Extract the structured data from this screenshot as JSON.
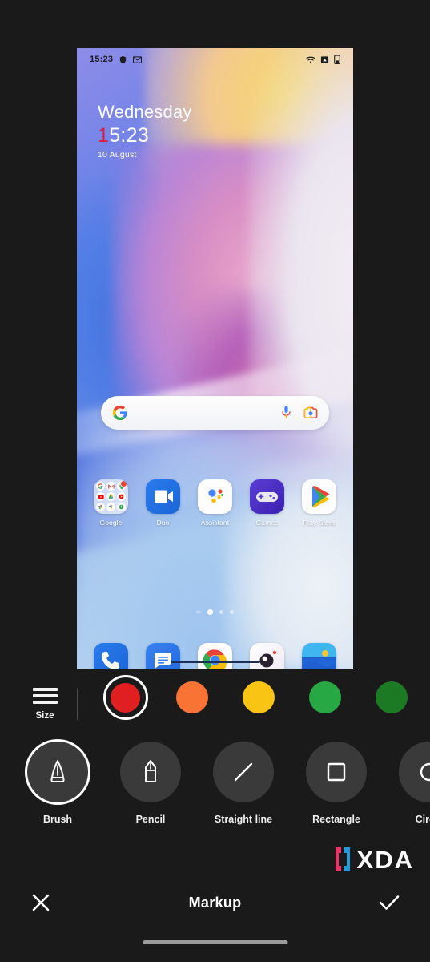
{
  "app": {
    "title": "Markup",
    "background": "#1a1a1a"
  },
  "preview": {
    "statusbar": {
      "time": "15:23",
      "left_icons": [
        "shield-icon",
        "mail-icon"
      ],
      "right_icons": [
        "wifi-icon",
        "cellular-signal-icon",
        "battery-icon"
      ]
    },
    "clock_widget": {
      "day": "Wednesday",
      "time_accent": "1",
      "time_rest": "5:23",
      "date": "10 August",
      "accent_color": "#d81f3c"
    },
    "search_bar": {
      "placeholder": "",
      "icons": [
        "google-g-icon",
        "microphone-icon",
        "google-lens-icon"
      ]
    },
    "apps": [
      {
        "label": "Google",
        "icon": "google-folder-icon",
        "badge": true
      },
      {
        "label": "Duo",
        "icon": "google-duo-icon",
        "badge": false
      },
      {
        "label": "Assistant",
        "icon": "google-assistant-icon",
        "badge": false
      },
      {
        "label": "Games",
        "icon": "google-play-games-icon",
        "badge": false
      },
      {
        "label": "Play Store",
        "icon": "google-play-store-icon",
        "badge": false
      }
    ],
    "page_dots": {
      "count": 4,
      "active_index": 1
    },
    "dock": [
      {
        "label": "Phone",
        "icon": "phone-icon"
      },
      {
        "label": "Messages",
        "icon": "messages-icon"
      },
      {
        "label": "Chrome",
        "icon": "chrome-icon"
      },
      {
        "label": "Camera",
        "icon": "camera-icon"
      },
      {
        "label": "Gallery",
        "icon": "gallery-icon"
      }
    ]
  },
  "toolbar": {
    "size_label": "Size",
    "size_icon": "size-bars-icon",
    "colors": [
      {
        "name": "red",
        "hex": "#e02020",
        "selected": true
      },
      {
        "name": "orange",
        "hex": "#f97335",
        "selected": false
      },
      {
        "name": "yellow",
        "hex": "#f9c413",
        "selected": false
      },
      {
        "name": "green",
        "hex": "#28a745",
        "selected": false
      },
      {
        "name": "dark-green",
        "hex": "#1d7a24",
        "selected": false
      }
    ],
    "tools": [
      {
        "label": "Brush",
        "icon": "brush-icon",
        "selected": true
      },
      {
        "label": "Pencil",
        "icon": "pencil-icon",
        "selected": false
      },
      {
        "label": "Straight line",
        "icon": "straight-line-icon",
        "selected": false
      },
      {
        "label": "Rectangle",
        "icon": "rectangle-icon",
        "selected": false
      },
      {
        "label": "Circle",
        "icon": "circle-icon",
        "selected": false
      }
    ]
  },
  "bottom_bar": {
    "cancel_icon": "close-icon",
    "title": "Markup",
    "confirm_icon": "check-icon"
  },
  "watermark": {
    "text": "XDA",
    "bracket_colors": [
      "#e8336d",
      "#1e9ae0"
    ]
  }
}
